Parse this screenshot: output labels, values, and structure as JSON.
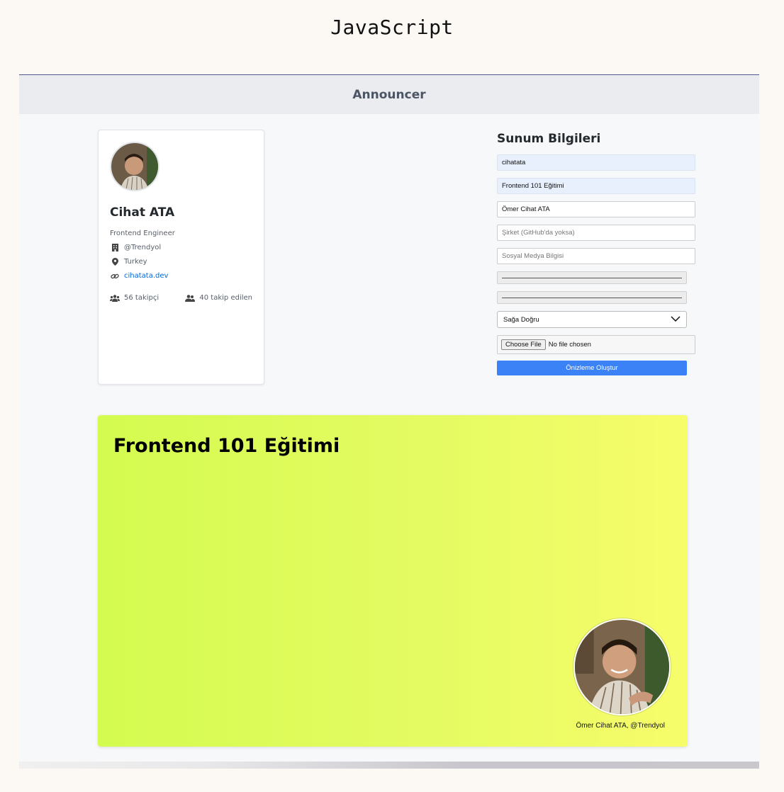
{
  "page": {
    "heading": "JavaScript"
  },
  "app": {
    "title": "Announcer"
  },
  "profile": {
    "name": "Cihat ATA",
    "title": "Frontend Engineer",
    "company": "@Trendyol",
    "location": "Turkey",
    "website": "cihatata.dev",
    "followers": "56 takipçi",
    "following": "40 takip edilen"
  },
  "form": {
    "title": "Sunum Bilgileri",
    "username_value": "cihatata",
    "talk_title_value": "Frontend 101 Eğitimi",
    "fullname_value": "Ömer Cihat ATA",
    "company_placeholder": "Şirket (GitHub'da yoksa)",
    "social_placeholder": "Sosyal Medya Bilgisi",
    "direction_selected": "Sağa Doğru",
    "file_button": "Choose File",
    "file_status": "No file chosen",
    "submit_label": "Önizleme Oluştur"
  },
  "preview": {
    "title": "Frontend 101 Eğitimi",
    "caption": "Ömer Cihat ATA, @Trendyol",
    "gradient_start": "#d4fb4f",
    "gradient_end": "#f7fd6a"
  },
  "colors": {
    "accent": "#3b82f6",
    "link": "#0366d6"
  },
  "icons": [
    "building-icon",
    "location-pin-icon",
    "link-icon",
    "followers-icon",
    "following-icon",
    "chevron-down-icon",
    "avatar"
  ]
}
